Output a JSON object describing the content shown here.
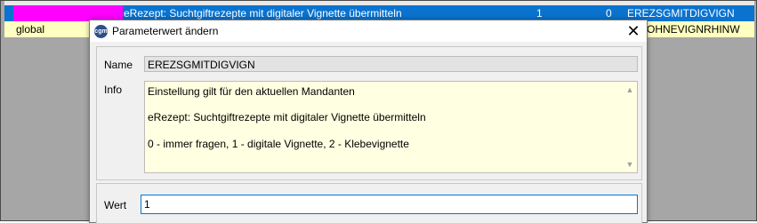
{
  "grid": {
    "selected_row": {
      "description": "eRezept: Suchtgiftrezepte mit digitaler Vignette übermitteln",
      "value_a": "1",
      "value_b": "0",
      "key": "EREZSGMITDIGVIGN"
    },
    "second_row": {
      "scope": "global",
      "key_partial": "OHNEVIGNRHINW"
    }
  },
  "dialog": {
    "icon_text": "cgm",
    "title": "Parameterwert ändern",
    "close_glyph": "✕",
    "name_label": "Name",
    "name_value": "EREZSGMITDIGVIGN",
    "info_label": "Info",
    "info_lines": [
      "Einstellung gilt für den aktuellen Mandanten",
      "eRezept: Suchtgiftrezepte mit digitaler Vignette übermitteln",
      "0 - immer fragen, 1 - digitale Vignette, 2 - Klebevignette"
    ],
    "wert_label": "Wert",
    "wert_value": "1"
  },
  "colors": {
    "selection_blue": "#0a73cf",
    "magenta_cell": "#ff00ff",
    "info_background": "#ffffe1",
    "row_yellow": "#ffffc0",
    "focus_border": "#0078d7"
  },
  "icons": [
    "app-logo-icon",
    "close-icon",
    "scroll-up-arrow-icon",
    "scroll-down-arrow-icon"
  ]
}
